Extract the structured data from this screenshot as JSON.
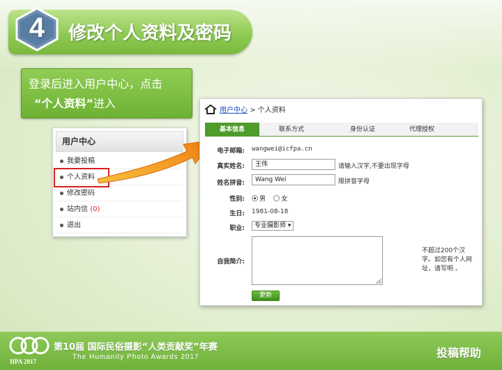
{
  "banner": {
    "number": "4",
    "title": "修改个人资料及密码"
  },
  "instruction": {
    "line1": "登录后进入用户中心，点击",
    "line2_highlight": "“个人资料”",
    "line2_rest": "进入"
  },
  "user_center": {
    "title": "用户中心",
    "items": [
      {
        "label": "我要投稿"
      },
      {
        "label": "个人资料"
      },
      {
        "label": "修改密码"
      },
      {
        "label": "站内信",
        "badge": "(0)"
      },
      {
        "label": "退出"
      }
    ]
  },
  "profile": {
    "breadcrumb": {
      "link": "用户中心",
      "sep": ">",
      "current": "个人资料"
    },
    "tabs": [
      "基本信息",
      "联系方式",
      "身份认证",
      "代理授权"
    ],
    "email": {
      "label": "电子邮箱:",
      "value": "wangwei@icfpa.cn"
    },
    "real_name": {
      "label": "真实姓名:",
      "value": "王伟",
      "hint": "请输入汉字,不要出现字母"
    },
    "pinyin_name": {
      "label": "姓名拼音:",
      "value": "Wang Wei",
      "hint": "限拼音字母"
    },
    "gender": {
      "label": "性别:",
      "options": [
        "男",
        "女"
      ],
      "selected": "男"
    },
    "birthday": {
      "label": "生日:",
      "value": "1981-08-18"
    },
    "occupation": {
      "label": "职业:",
      "value": "专业摄影师"
    },
    "bio": {
      "label": "自我简介:",
      "hint": "不超过200个汉字。如您有个人网址，请写明 。"
    },
    "submit_label": "更新"
  },
  "footer": {
    "logo_text": "HPA 2017",
    "title": "第10届 国际民俗摄影“人类贡献奖”年赛",
    "subtitle": "The Humanity Photo Awards 2017",
    "help": "投稿帮助"
  },
  "colors": {
    "accent": "#4f9c2c",
    "banner": "#8cc951",
    "highlight_box": "#d51f1f",
    "arrow": "#f29a1a"
  }
}
